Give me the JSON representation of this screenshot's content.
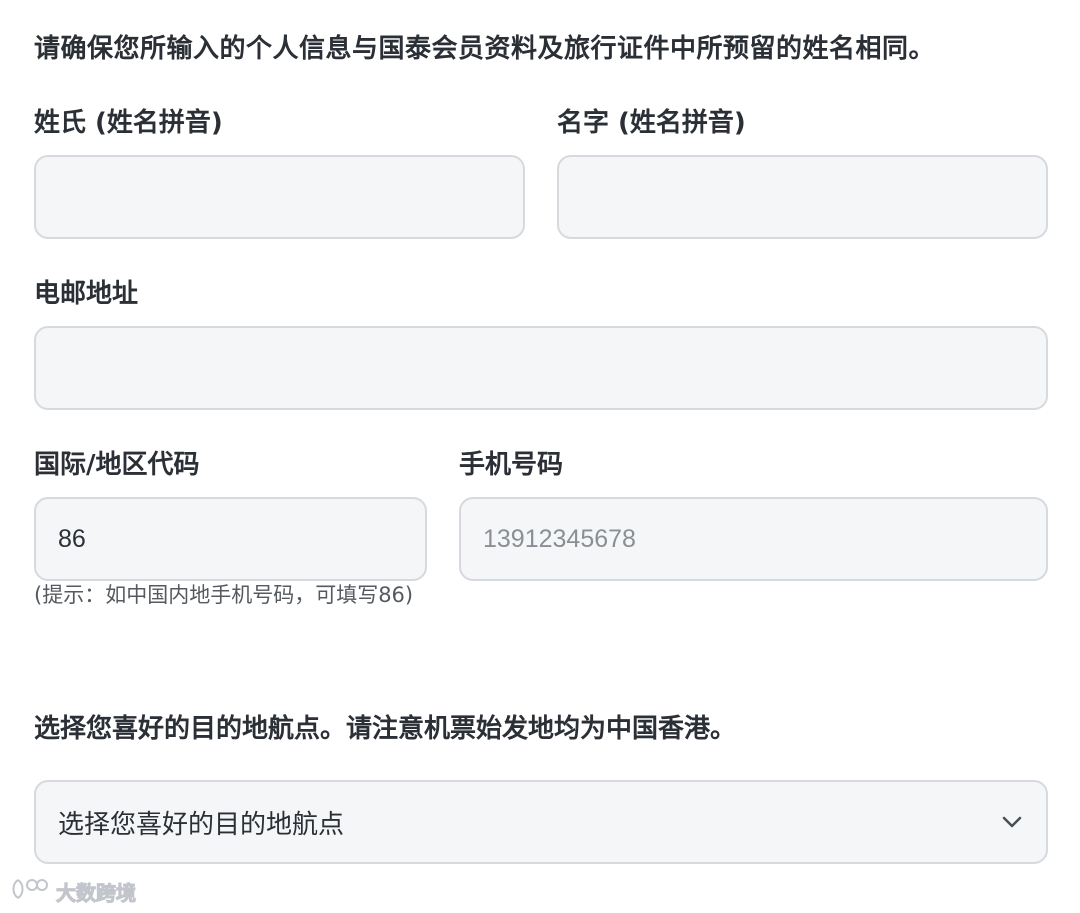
{
  "notice": "请确保您所输入的个人信息与国泰会员资料及旅行证件中所预留的姓名相同。",
  "form": {
    "surname": {
      "label": "姓氏 (姓名拼音)",
      "value": ""
    },
    "given_name": {
      "label": "名字 (姓名拼音)",
      "value": ""
    },
    "email": {
      "label": "电邮地址",
      "value": ""
    },
    "country_code": {
      "label": "国际/地区代码",
      "value": "86",
      "hint": "(提示：如中国内地手机号码，可填写86)"
    },
    "mobile": {
      "label": "手机号码",
      "value": "",
      "placeholder": "13912345678"
    },
    "destination": {
      "label": "选择您喜好的目的地航点。请注意机票始发地均为中国香港。",
      "selected": "选择您喜好的目的地航点",
      "icon": "chevron-down-icon"
    }
  },
  "watermark": {
    "text": "大数跨境",
    "icon": "logo-icon"
  },
  "colors": {
    "field_bg": "#f5f6f8",
    "field_border": "#d6d9de",
    "text": "#2b2f36",
    "placeholder": "#8a8f96"
  }
}
